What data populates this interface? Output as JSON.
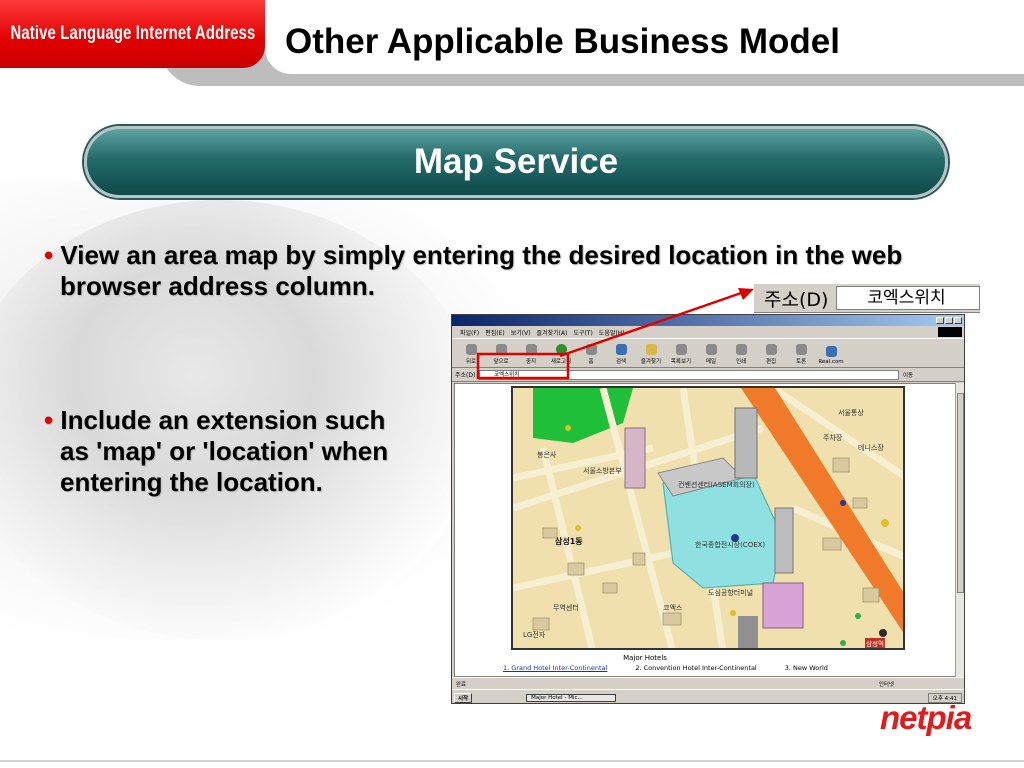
{
  "header": {
    "logo_text": "Native Language Internet Address",
    "title": "Other Applicable Business Model"
  },
  "section": {
    "title": "Map Service"
  },
  "bullets": [
    {
      "line1": "View an area map by simply entering the desired location in the web",
      "line2": "browser address column."
    },
    {
      "line1": "Include an extension such",
      "line2": "as 'map' or 'location' when",
      "line3": "entering the location."
    }
  ],
  "address_zoom": {
    "label": "주소(D)",
    "value": "코엑스위치"
  },
  "browser": {
    "menu": [
      "파일(F)",
      "편집(E)",
      "보기(V)",
      "즐겨찾기(A)",
      "도구(T)",
      "도움말(H)"
    ],
    "toolbar": [
      "뒤로",
      "앞으로",
      "중지",
      "새로고침",
      "홈",
      "검색",
      "즐겨찾기",
      "목록보기",
      "메일",
      "인쇄",
      "편집",
      "토론",
      "Real.com"
    ],
    "address_label": "주소(D)",
    "address_value": "코엑스위치",
    "go_label": "이동",
    "map_labels": {
      "l1": "코엑스",
      "l2": "한국종합전시장(COEX)",
      "l3": "컨벤션센터(ASEM회의장)",
      "l4": "삼성1동",
      "l5": "봉은사",
      "l6": "서울소방본부",
      "l7": "도심공항터미널",
      "l8": "LG전자",
      "l9": "무역센터",
      "l10": "테니스장",
      "l11": "주차장",
      "l12": "서울통상",
      "l13": "삼성역"
    },
    "hotels": {
      "title": "Major Hotels",
      "h1": "1. Grand Hotel Inter-Continental",
      "h2": "2. Convention Hotel Inter-Continental",
      "h3": "3. New World"
    },
    "status_left": "완료",
    "status_zone": "인터넷",
    "taskbar": {
      "start": "시작",
      "task": "Major Hotel - Mic...",
      "clock": "오후 4:41"
    }
  },
  "footer": {
    "brand": "netpia"
  },
  "colors": {
    "logo_red": "#e00000",
    "pill_teal": "#236a6a",
    "bullet_dot": "#e00000",
    "arrow_red": "#e00000",
    "brand_red": "#e21a1a"
  }
}
